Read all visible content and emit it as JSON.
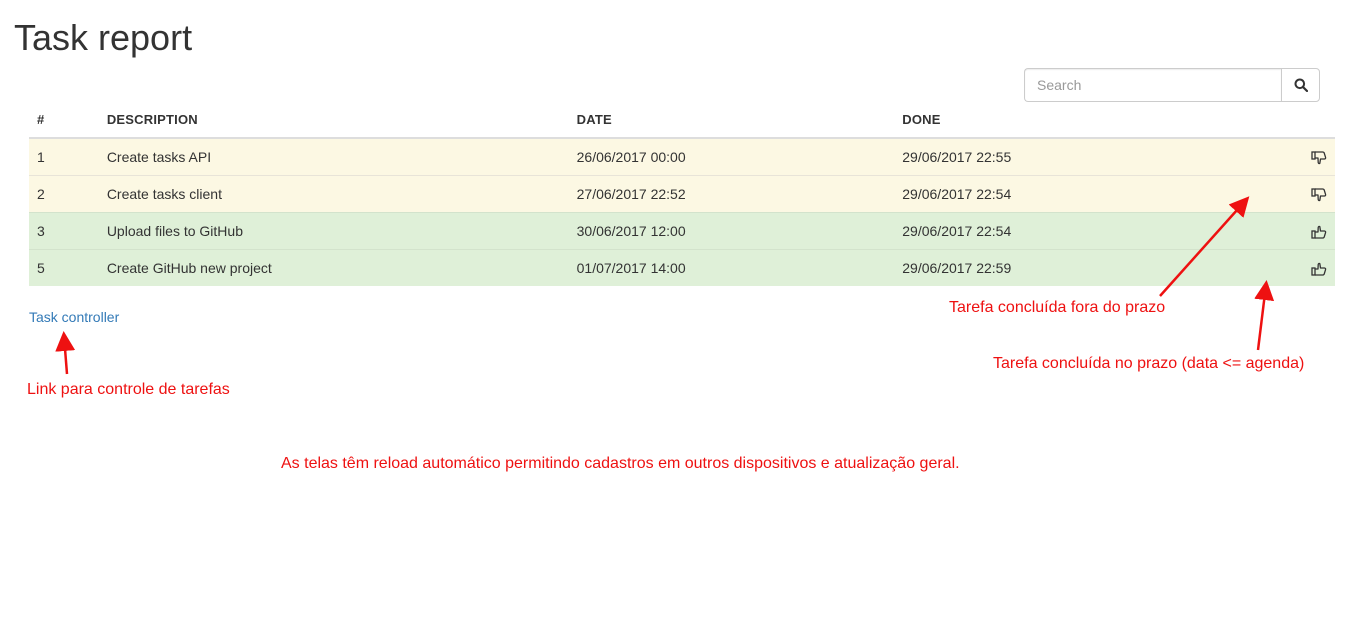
{
  "page": {
    "title": "Task report"
  },
  "search": {
    "placeholder": "Search",
    "icon": "search-icon"
  },
  "table": {
    "headers": {
      "num": "#",
      "description": "DESCRIPTION",
      "date": "DATE",
      "done": "DONE"
    },
    "rows": [
      {
        "num": "1",
        "description": "Create tasks API",
        "date": "26/06/2017 00:00",
        "done": "29/06/2017 22:55",
        "status": "late",
        "icon": "thumbs-down-icon"
      },
      {
        "num": "2",
        "description": "Create tasks client",
        "date": "27/06/2017 22:52",
        "done": "29/06/2017 22:54",
        "status": "late",
        "icon": "thumbs-down-icon"
      },
      {
        "num": "3",
        "description": "Upload files to GitHub",
        "date": "30/06/2017 12:00",
        "done": "29/06/2017 22:54",
        "status": "on-time",
        "icon": "thumbs-up-icon"
      },
      {
        "num": "5",
        "description": "Create GitHub new project",
        "date": "01/07/2017 14:00",
        "done": "29/06/2017 22:59",
        "status": "on-time",
        "icon": "thumbs-up-icon"
      }
    ]
  },
  "link": {
    "task_controller": "Task controller"
  },
  "annotations": {
    "late": "Tarefa concluída fora do prazo",
    "on_time": "Tarefa concluída no prazo (data <= agenda)",
    "link": "Link para controle de tarefas",
    "reload": "As telas têm reload automático permitindo cadastros em outros dispositivos e atualização geral."
  },
  "colors": {
    "late_row": "#fcf8e3",
    "on_time_row": "#dff0d8",
    "link": "#337ab7",
    "annotation": "#ee1111"
  }
}
